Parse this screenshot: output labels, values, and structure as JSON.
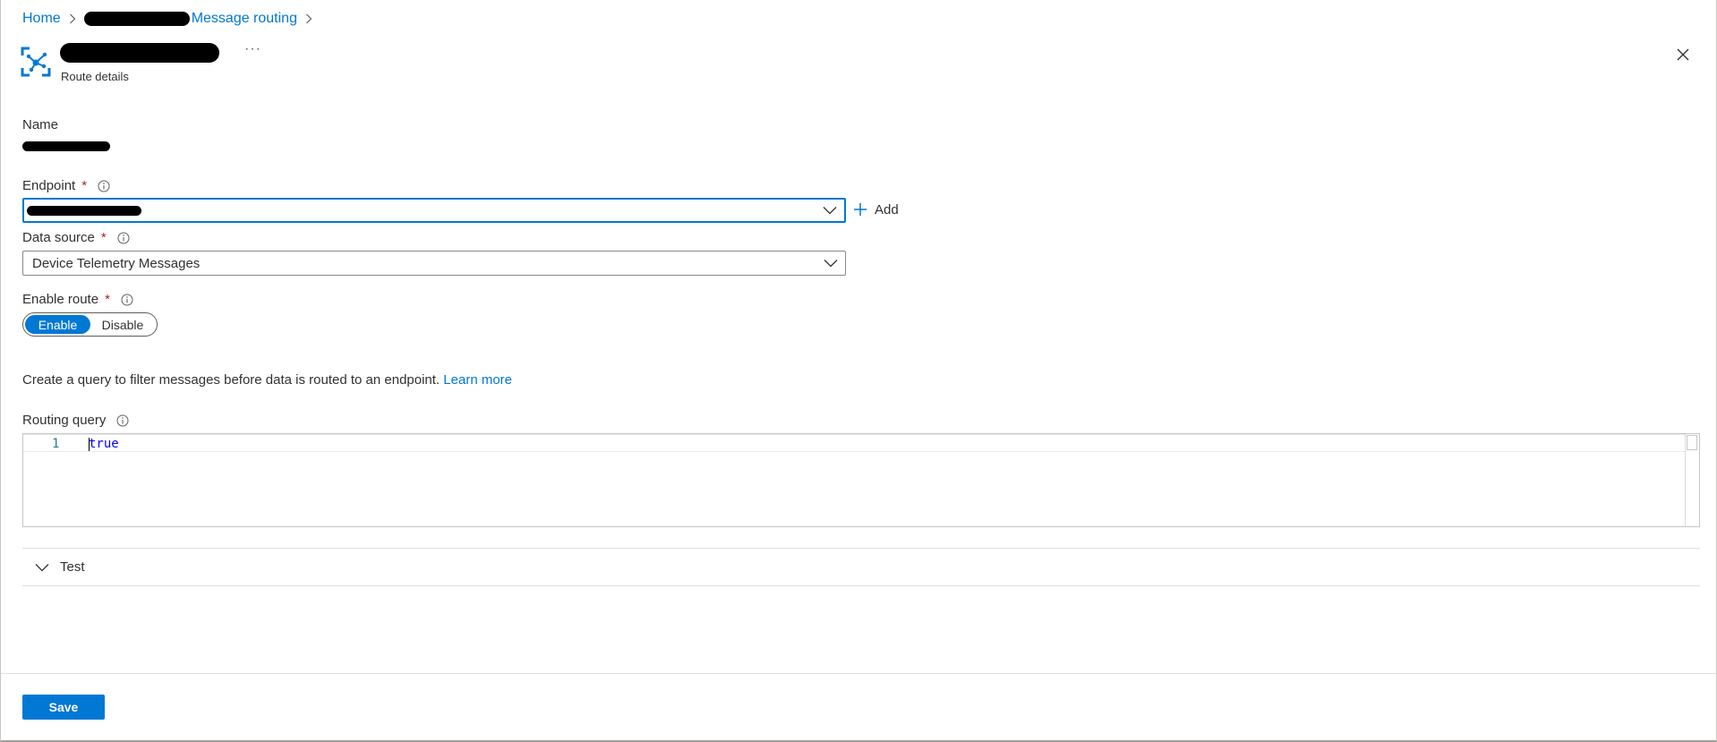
{
  "breadcrumb": {
    "home": "Home",
    "current": "Message routing"
  },
  "header": {
    "subtitle": "Route details",
    "more_label": "···"
  },
  "form": {
    "name_label": "Name",
    "endpoint_label": "Endpoint",
    "required_marker": "*",
    "add_label": "Add",
    "data_source_label": "Data source",
    "data_source_value": "Device Telemetry Messages",
    "enable_route_label": "Enable route",
    "enable_label": "Enable",
    "disable_label": "Disable",
    "enable_route_selected": "Enable",
    "query_description": "Create a query to filter messages before data is routed to an endpoint.",
    "learn_more": "Learn more",
    "routing_query_label": "Routing query",
    "editor_line_number": "1",
    "editor_code": "true"
  },
  "test": {
    "label": "Test"
  },
  "footer": {
    "save_label": "Save"
  },
  "colors": {
    "accent": "#0078d4",
    "required": "#a4262c"
  }
}
